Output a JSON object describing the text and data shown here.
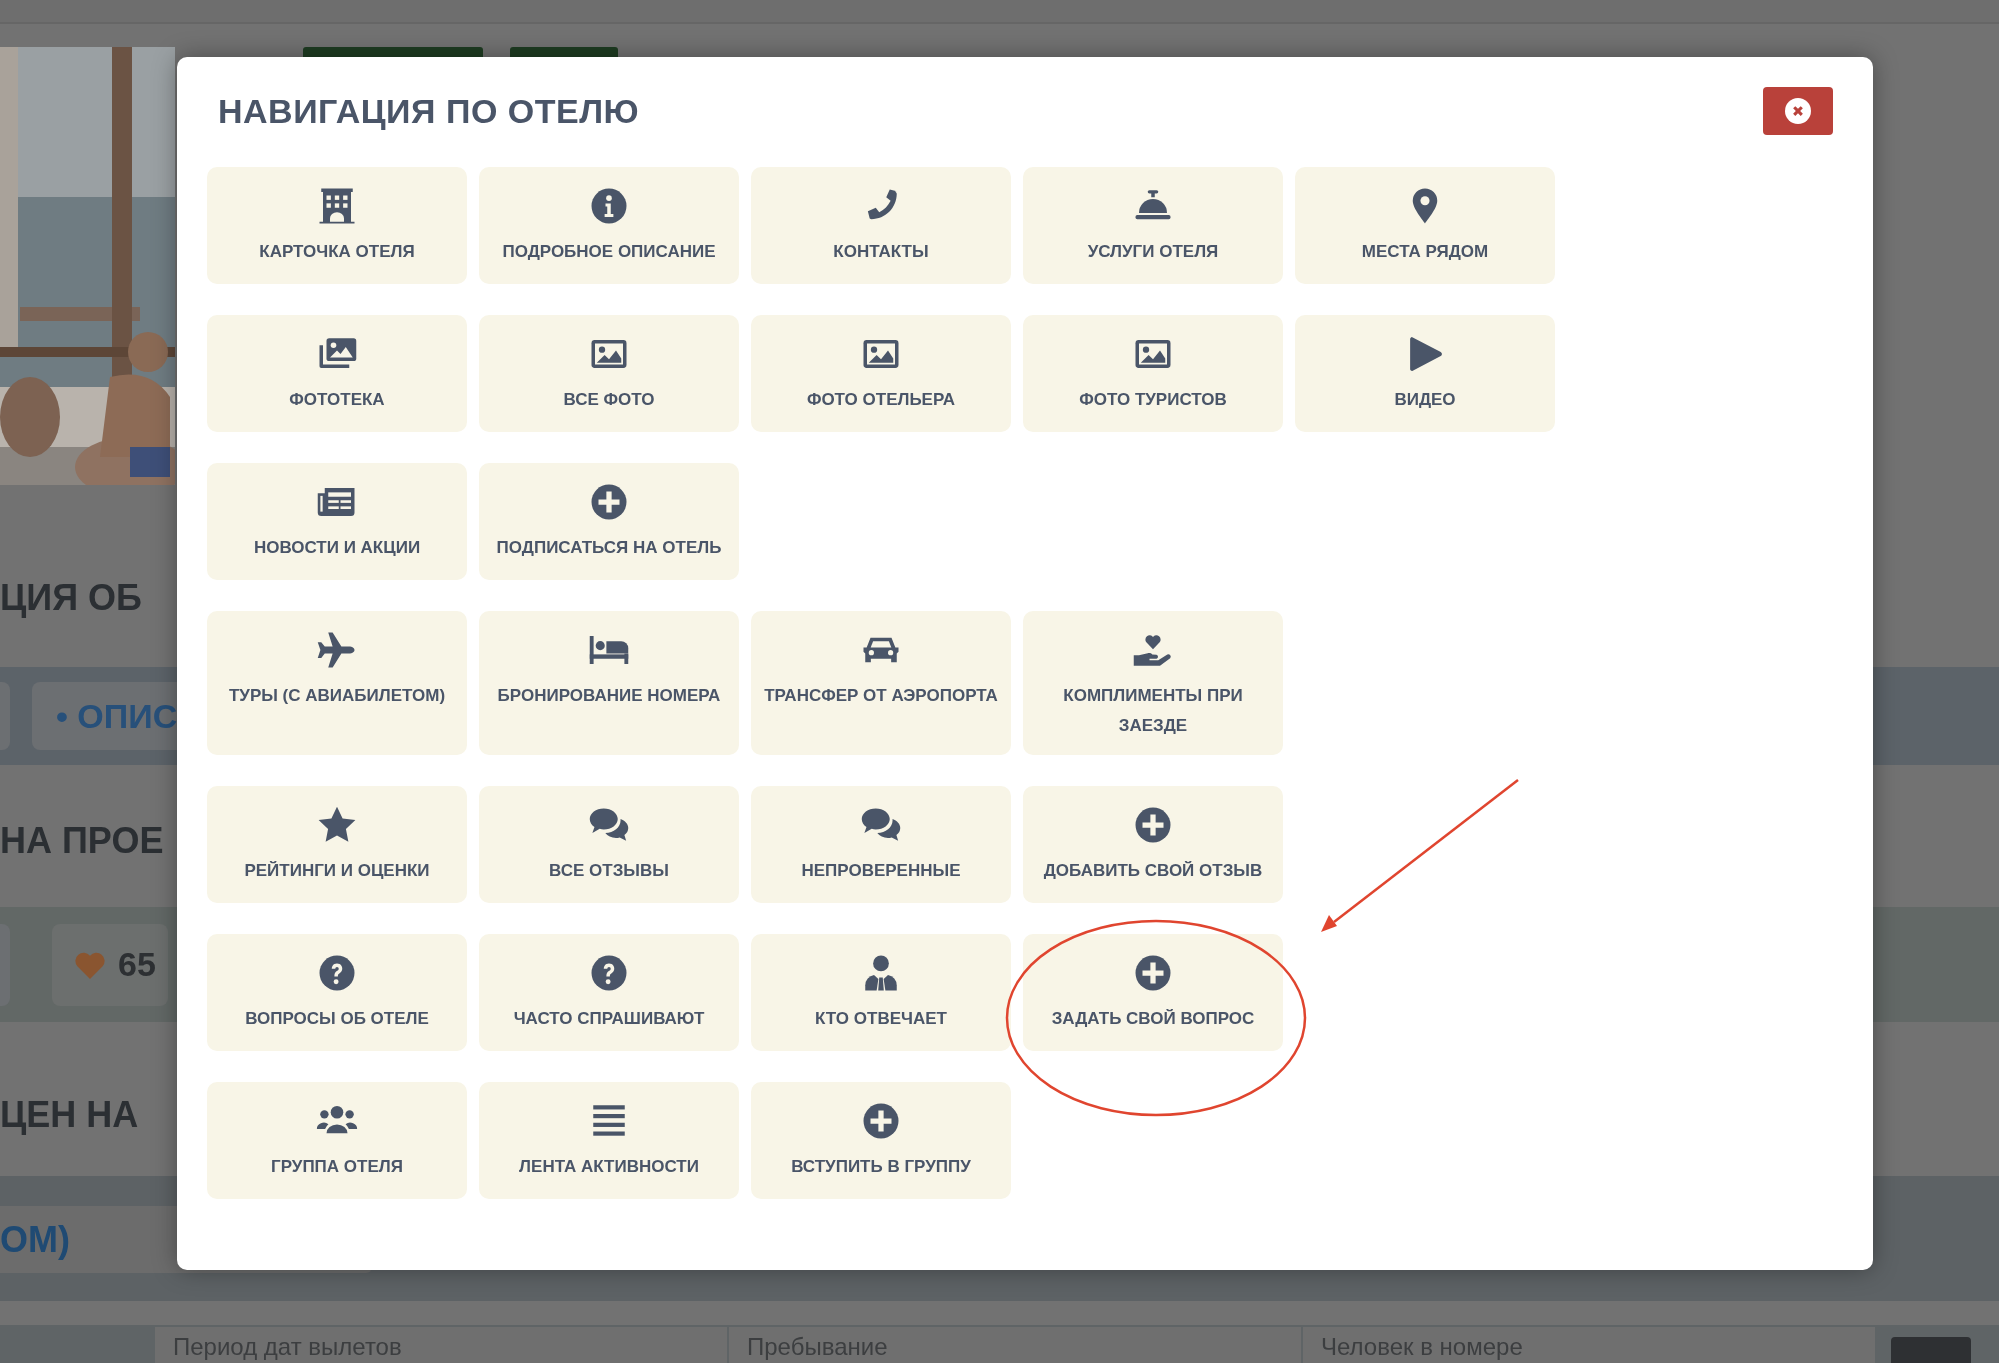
{
  "page": {
    "headings": [
      "ЦИЯ ОБ",
      "НА ПРОЕ",
      "ЦЕН НА"
    ],
    "tab_fragment": "• ОПИС",
    "likes": "65",
    "link_fragment": "ОМ)",
    "fields": [
      {
        "placeholder": "Период дат вылетов"
      },
      {
        "placeholder": "Пребывание"
      },
      {
        "placeholder": "Человек в номере"
      }
    ]
  },
  "modal": {
    "title": "НАВИГАЦИЯ ПО ОТЕЛЮ",
    "rows": [
      [
        {
          "label": "КАРТОЧКА ОТЕЛЯ"
        },
        {
          "label": "ПОДРОБНОЕ ОПИСАНИЕ"
        },
        {
          "label": "КОНТАКТЫ"
        },
        {
          "label": "УСЛУГИ ОТЕЛЯ"
        },
        {
          "label": "МЕСТА РЯДОМ"
        }
      ],
      [
        {
          "label": "ФОТОТЕКА"
        },
        {
          "label": "ВСЕ ФОТО"
        },
        {
          "label": "ФОТО ОТЕЛЬЕРА"
        },
        {
          "label": "ФОТО ТУРИСТОВ"
        },
        {
          "label": "ВИДЕО"
        }
      ],
      [
        {
          "label": "НОВОСТИ И АКЦИИ"
        },
        {
          "label": "ПОДПИСАТЬСЯ НА ОТЕЛЬ"
        }
      ],
      [
        {
          "label": "ТУРЫ (С АВИАБИЛЕТОМ)"
        },
        {
          "label": "БРОНИРОВАНИЕ НОМЕРА"
        },
        {
          "label": "ТРАНСФЕР ОТ АЭРОПОРТА"
        },
        {
          "label": "КОМПЛИМЕНТЫ ПРИ ЗАЕЗДЕ"
        }
      ],
      [
        {
          "label": "РЕЙТИНГИ И ОЦЕНКИ"
        },
        {
          "label": "ВСЕ ОТЗЫВЫ"
        },
        {
          "label": "НЕПРОВЕРЕННЫЕ"
        },
        {
          "label": "ДОБАВИТЬ СВОЙ ОТЗЫВ"
        }
      ],
      [
        {
          "label": "ВОПРОСЫ ОБ ОТЕЛЕ"
        },
        {
          "label": "ЧАСТО СПРАШИВАЮТ"
        },
        {
          "label": "КТО ОТВЕЧАЕТ"
        },
        {
          "label": "ЗАДАТЬ СВОЙ ВОПРОС"
        }
      ],
      [
        {
          "label": "ГРУППА ОТЕЛЯ"
        },
        {
          "label": "ЛЕНТА АКТИВНОСТИ"
        },
        {
          "label": "ВСТУПИТЬ В ГРУППУ"
        }
      ]
    ]
  }
}
